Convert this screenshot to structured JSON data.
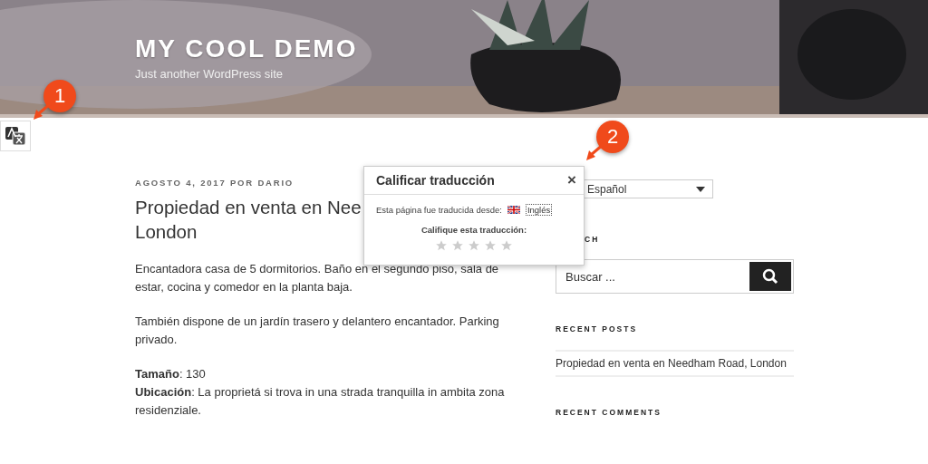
{
  "header": {
    "site_title": "MY COOL DEMO",
    "tagline": "Just another WordPress site"
  },
  "callouts": [
    {
      "number": "1"
    },
    {
      "number": "2"
    }
  ],
  "post": {
    "meta": "AGOSTO 4, 2017 POR DARIO",
    "title_lines": [
      "Propiedad en venta en Nee",
      "London"
    ],
    "paragraphs": [
      "Encantadora casa de 5 dormitorios. Baño en el segundo piso, sala de estar, cocina y comedor en la planta baja.",
      "También dispone de un jardín trasero y delantero encantador. Parking privado.",
      "**Tamaño**: 130\n**Ubicación**: La proprietá si trova in una strada tranquilla in ambita zona residenziale."
    ]
  },
  "rating_popup": {
    "title": "Calificar traducción",
    "close": "×",
    "source_label": "Esta página fue traducida desde:",
    "source_language": "Inglés",
    "prompt": "Califique esta traducción:",
    "stars": 0
  },
  "sidebar": {
    "language_select": {
      "value": "Español"
    },
    "search_heading": "CH",
    "search": {
      "placeholder": "Buscar ..."
    },
    "recent_posts": {
      "heading": "RECENT POSTS",
      "items": [
        "Propiedad en venta en Needham Road, London"
      ]
    },
    "recent_comments": {
      "heading": "RECENT COMMENTS"
    }
  }
}
